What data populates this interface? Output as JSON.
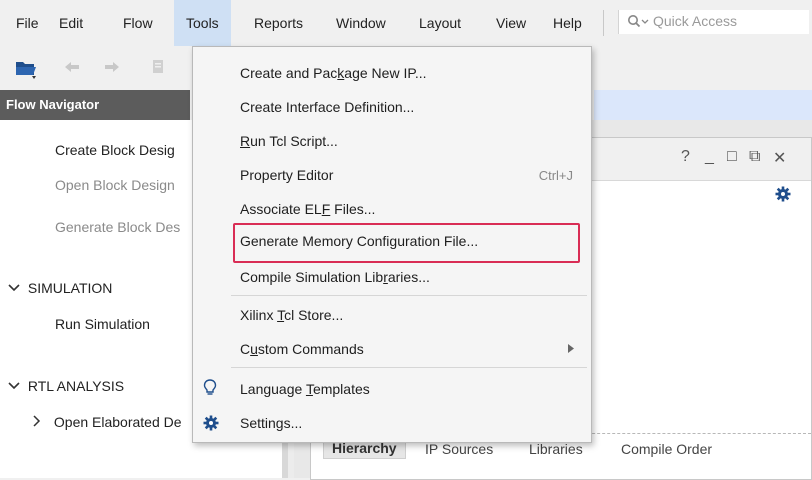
{
  "menubar": {
    "items": [
      {
        "key": "file",
        "label": "File"
      },
      {
        "key": "edit",
        "label": "Edit"
      },
      {
        "key": "flow",
        "label": "Flow"
      },
      {
        "key": "tools",
        "label": "Tools"
      },
      {
        "key": "reports",
        "label": "Reports"
      },
      {
        "key": "window",
        "label": "Window"
      },
      {
        "key": "layout",
        "label": "Layout"
      },
      {
        "key": "view",
        "label": "View"
      },
      {
        "key": "help",
        "label": "Help"
      }
    ],
    "quick_access_placeholder": "Quick Access"
  },
  "toolbar": {
    "icons": [
      "open-folder-icon",
      "undo-icon",
      "redo-icon",
      "copy-icon"
    ]
  },
  "flow_navigator": {
    "title": "Flow Navigator",
    "items": [
      {
        "label": "Create Block Desig",
        "enabled": true
      },
      {
        "label": "Open Block Design",
        "enabled": false
      },
      {
        "label": "Generate Block Des",
        "enabled": false
      }
    ],
    "simulation": {
      "label": "SIMULATION",
      "item": "Run Simulation"
    },
    "rtl_analysis": {
      "label": "RTL ANALYSIS",
      "item": "Open Elaborated De"
    }
  },
  "sources_panel": {
    "window_controls": [
      "?",
      "_",
      "□",
      "⧉",
      "✕"
    ],
    "tabs": [
      {
        "label": "Hierarchy",
        "selected": true
      },
      {
        "label": "IP Sources",
        "selected": false
      },
      {
        "label": "Libraries",
        "selected": false
      },
      {
        "label": "Compile Order",
        "selected": false
      }
    ]
  },
  "tools_menu": {
    "items": [
      {
        "key": "create_package_ip",
        "label": "Create and Package New IP..."
      },
      {
        "key": "create_interface",
        "label": "Create Interface Definition..."
      },
      {
        "key": "run_tcl",
        "label": "Run Tcl Script..."
      },
      {
        "key": "property_editor",
        "label": "Property Editor",
        "shortcut": "Ctrl+J"
      },
      {
        "key": "associate_elf",
        "label": "Associate ELF Files..."
      },
      {
        "key": "gen_mem_config",
        "label": "Generate Memory Configuration File...",
        "highlighted": true
      },
      {
        "key": "compile_sim_libs",
        "label": "Compile Simulation Libraries..."
      },
      {
        "key": "tcl_store",
        "label": "Xilinx Tcl Store..."
      },
      {
        "key": "custom_commands",
        "label": "Custom Commands",
        "submenu": true
      },
      {
        "key": "lang_templates",
        "label": "Language Templates",
        "icon": "lightbulb-icon"
      },
      {
        "key": "settings",
        "label": "Settings...",
        "icon": "gear-icon"
      }
    ]
  },
  "colors": {
    "active_menu_bg": "#cfe0f4",
    "highlight_border": "#d92d55",
    "navigator_header": "#5c5c5c",
    "icon_blue": "#1f4e8c"
  }
}
